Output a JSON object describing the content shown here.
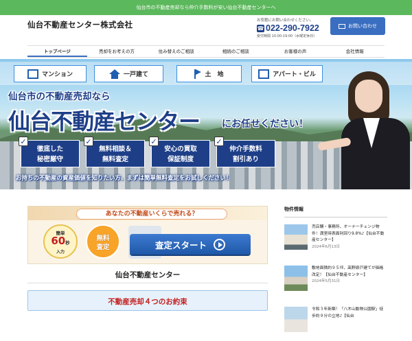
{
  "topbar": {
    "text": "仙台市の不動産売却なら仲介手数料が安い仙台不動産センターへ"
  },
  "header": {
    "logo": "仙台不動産センター株式会社",
    "contact_note": "お気軽にお問い合わせください。",
    "phone": "022-290-7922",
    "hours": "受付時間 10:00-19:00（水曜定休日）",
    "inquiry_button": "お問い合わせ"
  },
  "nav": {
    "items": [
      "トップページ",
      "売却をお考えの方",
      "住み替えのご相談",
      "相続のご相談",
      "お客様の声",
      "会社情報"
    ]
  },
  "hero": {
    "categories": [
      "マンション",
      "一戸建て",
      "土　地",
      "アパート・ビル"
    ],
    "subheadline": "仙台市の不動産売却なら",
    "headline": "仙台不動産センター",
    "headline_suffix": "にお任せください！",
    "features": [
      {
        "line1": "徹底した",
        "line2": "秘密厳守"
      },
      {
        "line1": "無料相談＆",
        "line2": "無料査定"
      },
      {
        "line1": "安心の買取",
        "line2": "保証制度"
      },
      {
        "line1": "仲介手数料",
        "line2": "割引あり"
      }
    ],
    "slogan": "お持ちの不動産の資産価値を知りたい方、まずは簡単無料査定をお試しください！"
  },
  "banner": {
    "question": "あなたの不動産いくらで売れる？",
    "simple": "簡単",
    "seconds": "60",
    "seconds_unit": "秒",
    "input": "入力",
    "free1": "無料",
    "free2": "査定",
    "start_button": "査定スタート"
  },
  "main": {
    "section_title": "仙台不動産センター",
    "promise_title": "不動産売却４つのお約束"
  },
  "sidebar": {
    "heading": "物件情報",
    "posts": [
      {
        "title": "売店舗・事務所、オーナーチェンジ物件！満室時表面利回り9.8%♪【仙台不動産センター】",
        "date": "2024年6月13日"
      },
      {
        "title": "敷地面積約９５坪、高野原戸建てが価格改定！【仙台不動産センター】",
        "date": "2024年5月31日"
      },
      {
        "title": "令和３年新築！「八木山動物公園駅」徒歩約９分の立地♪【仙台",
        "date": ""
      }
    ]
  }
}
